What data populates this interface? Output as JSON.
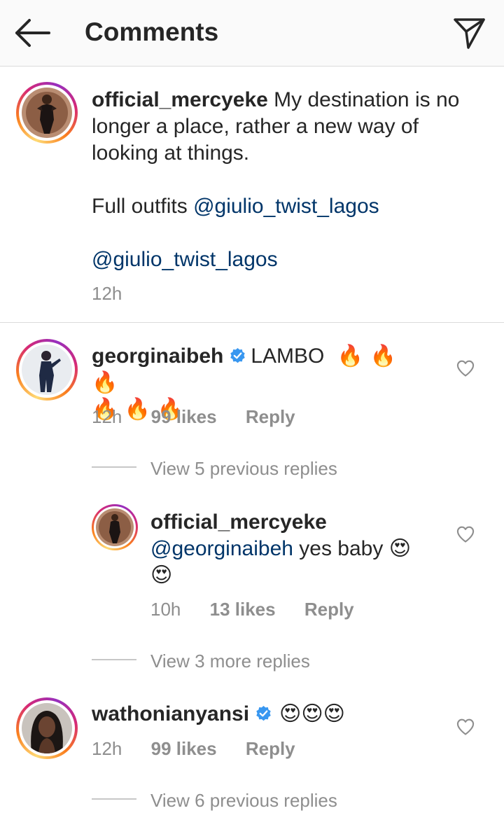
{
  "header": {
    "title": "Comments"
  },
  "caption": {
    "username": "official_mercyeke",
    "text": "My destination is no longer a place, rather a new way of looking at things.",
    "line2_prefix": "Full outfits",
    "mention1": "@giulio_twist_lagos",
    "mention2": "@giulio_twist_lagos",
    "time": "12h"
  },
  "comments": [
    {
      "username": "georginaibeh",
      "verified": true,
      "text": "LAMBO",
      "emoji_line1": "🔥 🔥 🔥",
      "emoji_line2": "🔥 🔥 🔥",
      "time": "12h",
      "likes": "99 likes",
      "reply_label": "Reply",
      "view_replies": "View 5 previous replies"
    },
    {
      "username": "official_mercyeke",
      "mention": "@georginaibeh",
      "text": "yes baby",
      "emoji_inline": "😍",
      "emoji_line2": "😍",
      "time": "10h",
      "likes": "13 likes",
      "reply_label": "Reply",
      "view_replies": "View 3 more replies"
    },
    {
      "username": "wathonianyansi",
      "verified": true,
      "emojis": "😍😍😍",
      "time": "12h",
      "likes": "99 likes",
      "reply_label": "Reply",
      "view_replies": "View 6 previous replies"
    }
  ],
  "colors": {
    "mention": "#003569",
    "muted": "#8e8e8e",
    "verified": "#3897f0"
  }
}
